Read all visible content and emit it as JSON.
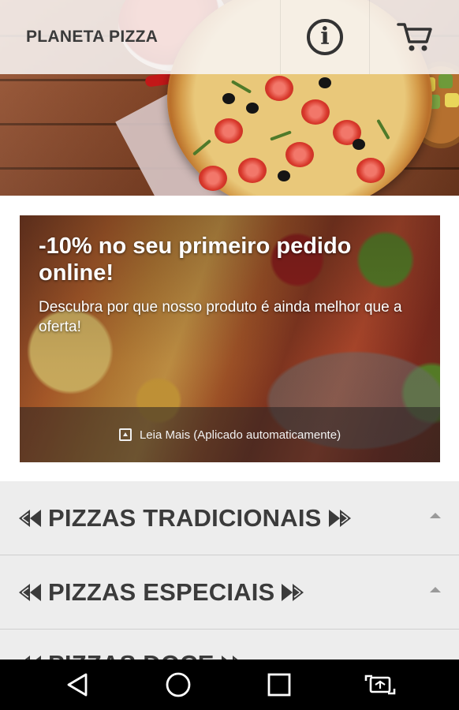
{
  "app": {
    "title": "PLANETA PIZZA",
    "info_icon": "info-icon",
    "cart_icon": "cart-icon"
  },
  "promo": {
    "headline": "-10% no seu primeiro pedido online!",
    "subtitle": "Descubra por que nosso produto é ainda melhor que a oferta!",
    "read_more": "Leia Mais (Aplicado automaticamente)"
  },
  "categories": [
    {
      "label": "PIZZAS TRADICIONAIS",
      "expanded": false
    },
    {
      "label": "PIZZAS ESPECIAIS",
      "expanded": false
    },
    {
      "label": "PIZZAS DOCE",
      "expanded": false
    }
  ],
  "navbar": {
    "back_icon": "back-triangle-icon",
    "home_icon": "home-circle-icon",
    "recents_icon": "recents-square-icon",
    "rotate_icon": "rotate-screen-icon"
  },
  "colors": {
    "appbar_bg": "#f7f4f2",
    "title_text": "#3a3a3a",
    "category_bg": "#ededed",
    "category_text": "#3b3b3b",
    "navbar_bg": "#000000"
  }
}
